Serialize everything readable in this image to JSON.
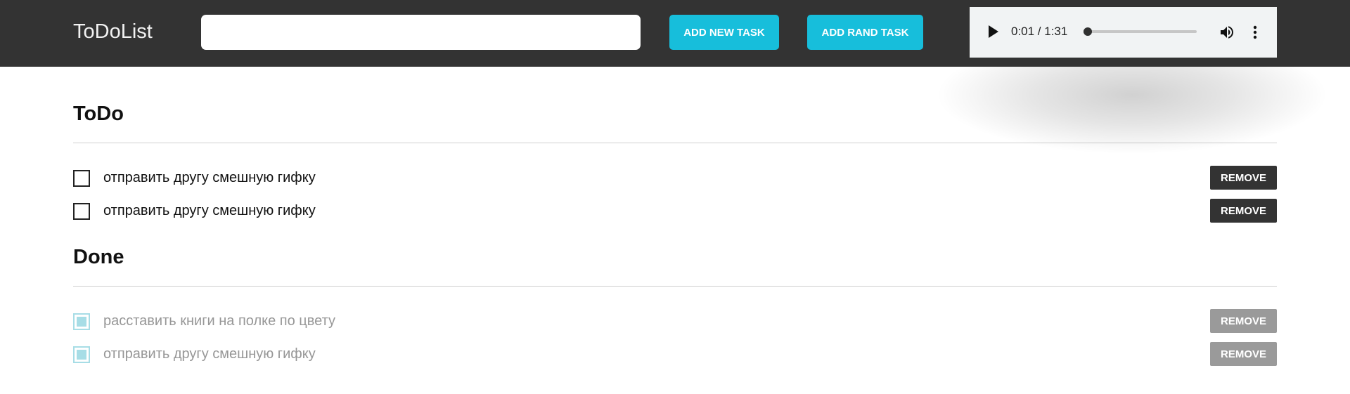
{
  "header": {
    "brand": "ToDoList",
    "input": {
      "value": "",
      "placeholder": ""
    },
    "add_new_label": "ADD NEW TASK",
    "add_rand_label": "ADD RAND TASK",
    "audio": {
      "current_time": "0:01",
      "duration": "1:31",
      "time_text": "0:01 / 1:31",
      "progress_fraction": 0.011
    }
  },
  "todo": {
    "title": "ToDo",
    "tasks": [
      {
        "label": "отправить другу смешную гифку",
        "remove_label": "REMOVE"
      },
      {
        "label": "отправить другу смешную гифку",
        "remove_label": "REMOVE"
      }
    ]
  },
  "done": {
    "title": "Done",
    "tasks": [
      {
        "label": "расставить книги на полке по цвету",
        "remove_label": "REMOVE"
      },
      {
        "label": "отправить другу смешную гифку",
        "remove_label": "REMOVE"
      }
    ]
  },
  "colors": {
    "header_bg": "#333333",
    "accent": "#17bedb",
    "checked": "#a7dde6",
    "done_text": "#979797",
    "remove_done_bg": "#9a9a9a"
  },
  "icons": {
    "play": "play-icon",
    "volume": "volume-icon",
    "more": "more-vert-icon"
  }
}
